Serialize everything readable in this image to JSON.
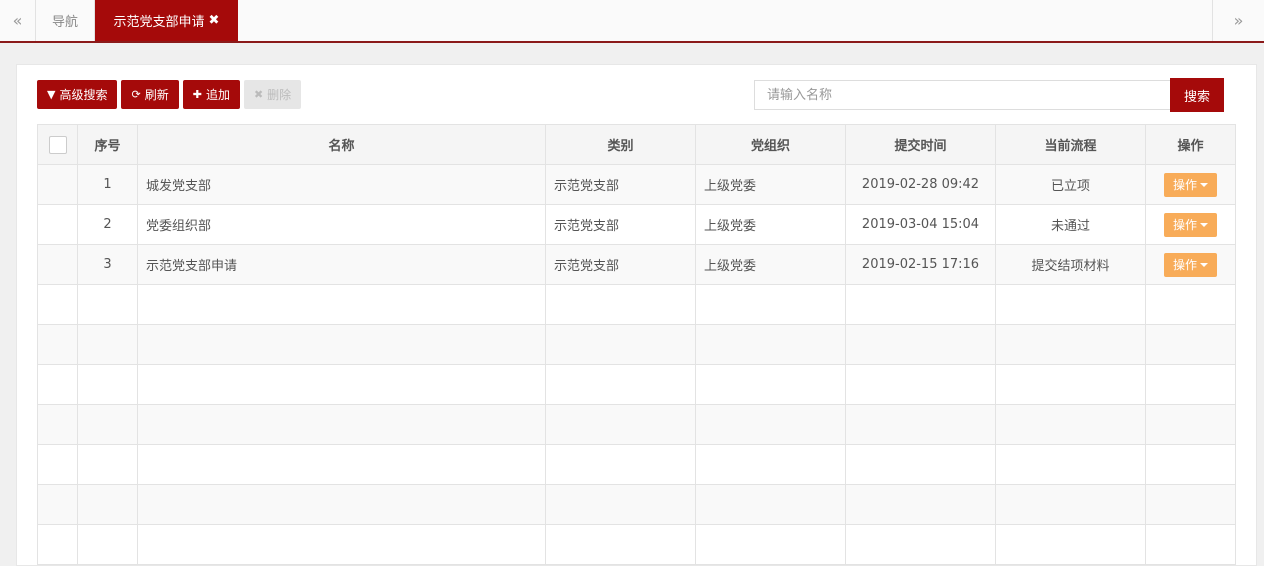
{
  "tabs": {
    "nav_left": "«",
    "nav_right": "»",
    "home": "导航",
    "active": "示范党支部申请",
    "close_icon": "✖"
  },
  "toolbar": {
    "advanced_search": {
      "icon": "▼",
      "label": "高级搜索"
    },
    "refresh": {
      "icon": "⟳",
      "label": "刷新"
    },
    "add": {
      "icon": "✚",
      "label": "追加"
    },
    "delete": {
      "icon": "✖",
      "label": "删除"
    }
  },
  "search": {
    "placeholder": "请输入名称",
    "button": "搜索"
  },
  "table": {
    "headers": [
      "序号",
      "名称",
      "类别",
      "党组织",
      "提交时间",
      "当前流程",
      "操作"
    ],
    "rows": [
      {
        "no": "1",
        "name": "城发党支部",
        "category": "示范党支部",
        "org": "上级党委",
        "time": "2019-02-28 09:42",
        "flow": "已立项",
        "op": "操作"
      },
      {
        "no": "2",
        "name": "党委组织部",
        "category": "示范党支部",
        "org": "上级党委",
        "time": "2019-03-04 15:04",
        "flow": "未通过",
        "op": "操作"
      },
      {
        "no": "3",
        "name": "示范党支部申请",
        "category": "示范党支部",
        "org": "上级党委",
        "time": "2019-02-15 17:16",
        "flow": "提交结项材料",
        "op": "操作"
      }
    ]
  },
  "colors": {
    "brand": "#a50a0a",
    "action": "#f8ac59"
  }
}
